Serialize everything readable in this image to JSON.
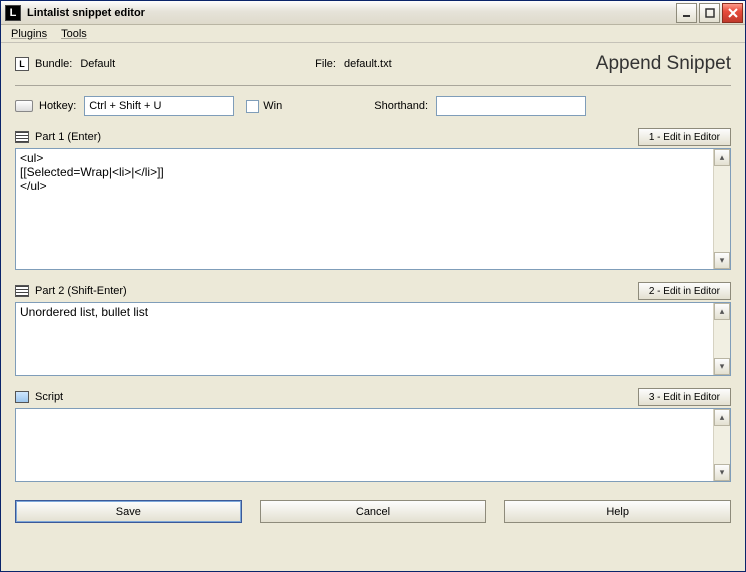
{
  "window": {
    "title": "Lintalist snippet editor",
    "app_icon_letter": "L"
  },
  "menubar": {
    "plugins": "Plugins",
    "tools": "Tools"
  },
  "header": {
    "bundle_label": "Bundle:",
    "bundle_value": "Default",
    "file_label": "File:",
    "file_value": "default.txt",
    "mode_title": "Append Snippet"
  },
  "hotkey": {
    "label": "Hotkey:",
    "value": "Ctrl + Shift + U",
    "win_label": "Win"
  },
  "shorthand": {
    "label": "Shorthand:",
    "value": ""
  },
  "part1": {
    "label": "Part 1 (Enter)",
    "edit_button": "1 - Edit in Editor",
    "text": "<ul>\n[[Selected=Wrap|<li>|</li>]]\n</ul>"
  },
  "part2": {
    "label": "Part 2 (Shift-Enter)",
    "edit_button": "2 - Edit in Editor",
    "text": "Unordered list, bullet list"
  },
  "script": {
    "label": "Script",
    "edit_button": "3 - Edit in Editor",
    "text": ""
  },
  "buttons": {
    "save": "Save",
    "cancel": "Cancel",
    "help": "Help"
  }
}
